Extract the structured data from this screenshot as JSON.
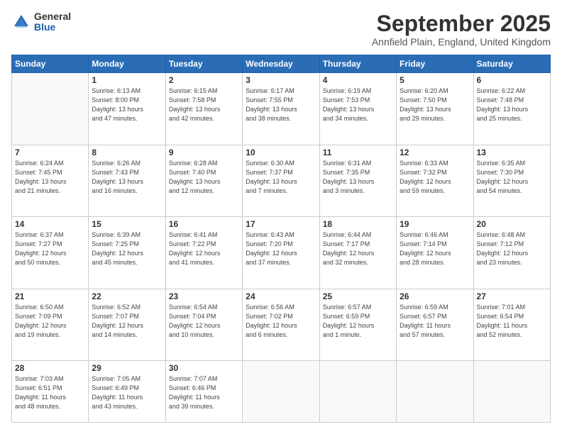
{
  "logo": {
    "general": "General",
    "blue": "Blue"
  },
  "header": {
    "month": "September 2025",
    "location": "Annfield Plain, England, United Kingdom"
  },
  "weekdays": [
    "Sunday",
    "Monday",
    "Tuesday",
    "Wednesday",
    "Thursday",
    "Friday",
    "Saturday"
  ],
  "weeks": [
    [
      {
        "day": "",
        "info": ""
      },
      {
        "day": "1",
        "info": "Sunrise: 6:13 AM\nSunset: 8:00 PM\nDaylight: 13 hours\nand 47 minutes."
      },
      {
        "day": "2",
        "info": "Sunrise: 6:15 AM\nSunset: 7:58 PM\nDaylight: 13 hours\nand 42 minutes."
      },
      {
        "day": "3",
        "info": "Sunrise: 6:17 AM\nSunset: 7:55 PM\nDaylight: 13 hours\nand 38 minutes."
      },
      {
        "day": "4",
        "info": "Sunrise: 6:19 AM\nSunset: 7:53 PM\nDaylight: 13 hours\nand 34 minutes."
      },
      {
        "day": "5",
        "info": "Sunrise: 6:20 AM\nSunset: 7:50 PM\nDaylight: 13 hours\nand 29 minutes."
      },
      {
        "day": "6",
        "info": "Sunrise: 6:22 AM\nSunset: 7:48 PM\nDaylight: 13 hours\nand 25 minutes."
      }
    ],
    [
      {
        "day": "7",
        "info": "Sunrise: 6:24 AM\nSunset: 7:45 PM\nDaylight: 13 hours\nand 21 minutes."
      },
      {
        "day": "8",
        "info": "Sunrise: 6:26 AM\nSunset: 7:43 PM\nDaylight: 13 hours\nand 16 minutes."
      },
      {
        "day": "9",
        "info": "Sunrise: 6:28 AM\nSunset: 7:40 PM\nDaylight: 13 hours\nand 12 minutes."
      },
      {
        "day": "10",
        "info": "Sunrise: 6:30 AM\nSunset: 7:37 PM\nDaylight: 13 hours\nand 7 minutes."
      },
      {
        "day": "11",
        "info": "Sunrise: 6:31 AM\nSunset: 7:35 PM\nDaylight: 13 hours\nand 3 minutes."
      },
      {
        "day": "12",
        "info": "Sunrise: 6:33 AM\nSunset: 7:32 PM\nDaylight: 12 hours\nand 59 minutes."
      },
      {
        "day": "13",
        "info": "Sunrise: 6:35 AM\nSunset: 7:30 PM\nDaylight: 12 hours\nand 54 minutes."
      }
    ],
    [
      {
        "day": "14",
        "info": "Sunrise: 6:37 AM\nSunset: 7:27 PM\nDaylight: 12 hours\nand 50 minutes."
      },
      {
        "day": "15",
        "info": "Sunrise: 6:39 AM\nSunset: 7:25 PM\nDaylight: 12 hours\nand 45 minutes."
      },
      {
        "day": "16",
        "info": "Sunrise: 6:41 AM\nSunset: 7:22 PM\nDaylight: 12 hours\nand 41 minutes."
      },
      {
        "day": "17",
        "info": "Sunrise: 6:43 AM\nSunset: 7:20 PM\nDaylight: 12 hours\nand 37 minutes."
      },
      {
        "day": "18",
        "info": "Sunrise: 6:44 AM\nSunset: 7:17 PM\nDaylight: 12 hours\nand 32 minutes."
      },
      {
        "day": "19",
        "info": "Sunrise: 6:46 AM\nSunset: 7:14 PM\nDaylight: 12 hours\nand 28 minutes."
      },
      {
        "day": "20",
        "info": "Sunrise: 6:48 AM\nSunset: 7:12 PM\nDaylight: 12 hours\nand 23 minutes."
      }
    ],
    [
      {
        "day": "21",
        "info": "Sunrise: 6:50 AM\nSunset: 7:09 PM\nDaylight: 12 hours\nand 19 minutes."
      },
      {
        "day": "22",
        "info": "Sunrise: 6:52 AM\nSunset: 7:07 PM\nDaylight: 12 hours\nand 14 minutes."
      },
      {
        "day": "23",
        "info": "Sunrise: 6:54 AM\nSunset: 7:04 PM\nDaylight: 12 hours\nand 10 minutes."
      },
      {
        "day": "24",
        "info": "Sunrise: 6:56 AM\nSunset: 7:02 PM\nDaylight: 12 hours\nand 6 minutes."
      },
      {
        "day": "25",
        "info": "Sunrise: 6:57 AM\nSunset: 6:59 PM\nDaylight: 12 hours\nand 1 minute."
      },
      {
        "day": "26",
        "info": "Sunrise: 6:59 AM\nSunset: 6:57 PM\nDaylight: 11 hours\nand 57 minutes."
      },
      {
        "day": "27",
        "info": "Sunrise: 7:01 AM\nSunset: 6:54 PM\nDaylight: 11 hours\nand 52 minutes."
      }
    ],
    [
      {
        "day": "28",
        "info": "Sunrise: 7:03 AM\nSunset: 6:51 PM\nDaylight: 11 hours\nand 48 minutes."
      },
      {
        "day": "29",
        "info": "Sunrise: 7:05 AM\nSunset: 6:49 PM\nDaylight: 11 hours\nand 43 minutes."
      },
      {
        "day": "30",
        "info": "Sunrise: 7:07 AM\nSunset: 6:46 PM\nDaylight: 11 hours\nand 39 minutes."
      },
      {
        "day": "",
        "info": ""
      },
      {
        "day": "",
        "info": ""
      },
      {
        "day": "",
        "info": ""
      },
      {
        "day": "",
        "info": ""
      }
    ]
  ]
}
